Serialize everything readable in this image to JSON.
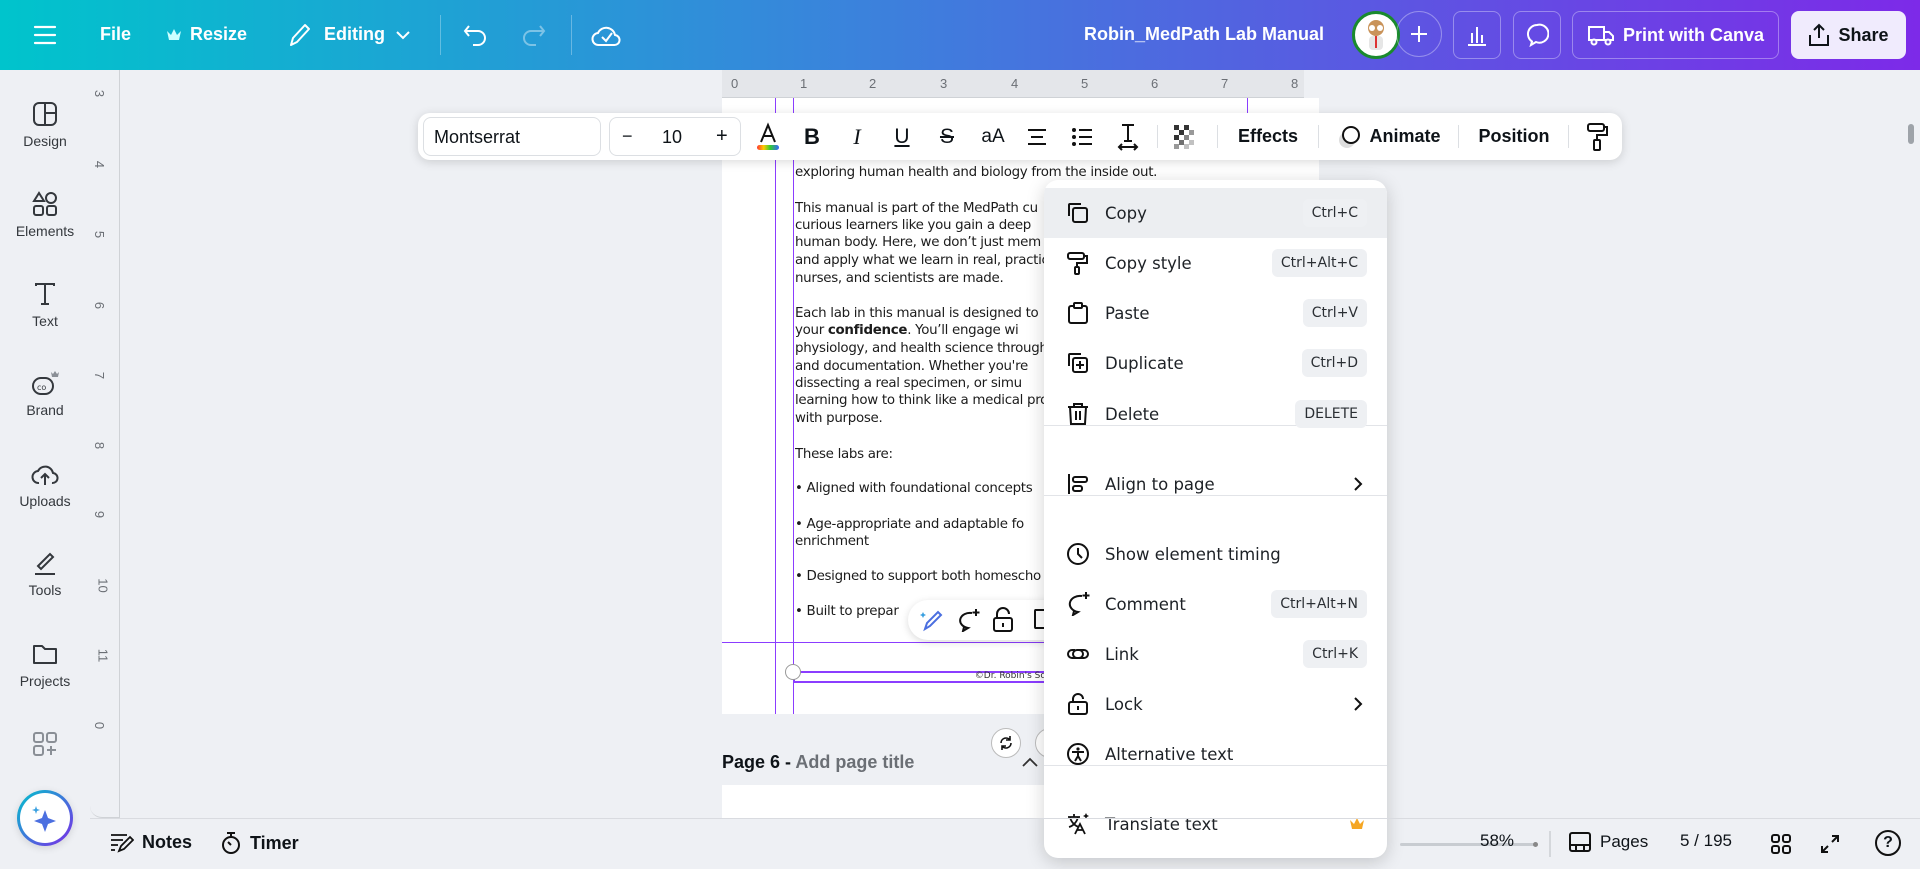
{
  "topbar": {
    "file": "File",
    "resize": "Resize",
    "editing": "Editing",
    "title": "Robin_MedPath Lab Manual",
    "print": "Print with Canva",
    "share": "Share"
  },
  "sidebar": {
    "items": [
      {
        "label": "Design"
      },
      {
        "label": "Elements"
      },
      {
        "label": "Text"
      },
      {
        "label": "Brand"
      },
      {
        "label": "Uploads"
      },
      {
        "label": "Tools"
      },
      {
        "label": "Projects"
      }
    ]
  },
  "ruler": {
    "h": [
      "0",
      "1",
      "2",
      "3",
      "4",
      "5",
      "6",
      "7",
      "8"
    ],
    "v": [
      "3",
      "4",
      "5",
      "6",
      "7",
      "8",
      "9",
      "10",
      "11",
      "0"
    ]
  },
  "text_toolbar": {
    "font": "Montserrat",
    "size_minus": "−",
    "size": "10",
    "size_plus": "+",
    "case": "aA",
    "effects": "Effects",
    "animate": "Animate",
    "position": "Position"
  },
  "page": {
    "lines": [
      "exploring human health and biology from the inside out.",
      "This manual is part of the MedPath cu",
      "curious learners like you gain a deep",
      "human body. Here, we don’t just mem",
      "and apply what we learn in real, practic",
      "nurses, and scientists are made.",
      "Each lab in this manual is designed to",
      "your confidence. You’ll engage wi",
      "physiology, and health science through",
      "and documentation. Whether you're",
      "dissecting a real specimen, or simu",
      "learning how to think like a medical pro",
      "with purpose.",
      "These labs are:",
      "•  Aligned with foundational concepts",
      "•  Age-appropriate and adaptable fo",
      "    enrichment",
      "•  Designed to support both homescho",
      "•  Built to prepar"
    ],
    "footer": "©Dr. Robin's Sch",
    "next_page_label": "Page 6 - ",
    "next_page_title_placeholder": "Add page title"
  },
  "context_menu": {
    "items": [
      {
        "label": "Copy",
        "shortcut": "Ctrl+C",
        "icon": "copy-icon"
      },
      {
        "label": "Copy style",
        "shortcut": "Ctrl+Alt+C",
        "icon": "paint-roller-icon"
      },
      {
        "label": "Paste",
        "shortcut": "Ctrl+V",
        "icon": "clipboard-icon"
      },
      {
        "label": "Duplicate",
        "shortcut": "Ctrl+D",
        "icon": "duplicate-icon"
      },
      {
        "label": "Delete",
        "shortcut": "DELETE",
        "icon": "trash-icon"
      },
      {
        "label": "Align to page",
        "icon": "align-icon"
      },
      {
        "label": "Show element timing",
        "icon": "clock-icon"
      },
      {
        "label": "Comment",
        "shortcut": "Ctrl+Alt+N",
        "icon": "comment-add-icon"
      },
      {
        "label": "Link",
        "shortcut": "Ctrl+K",
        "icon": "link-icon"
      },
      {
        "label": "Lock",
        "icon": "lock-icon"
      },
      {
        "label": "Alternative text",
        "icon": "accessibility-icon"
      },
      {
        "label": "Translate text",
        "icon": "translate-icon"
      }
    ]
  },
  "bottombar": {
    "notes": "Notes",
    "timer": "Timer",
    "zoom": "58%",
    "zoom_fraction": 0.58,
    "pages": "Pages",
    "page_count": "5 / 195"
  },
  "colors": {
    "accent": "#8b3dff",
    "gradient_start": "#00c4cc",
    "gradient_end": "#7d2ae8",
    "premium": "#f5a623"
  }
}
